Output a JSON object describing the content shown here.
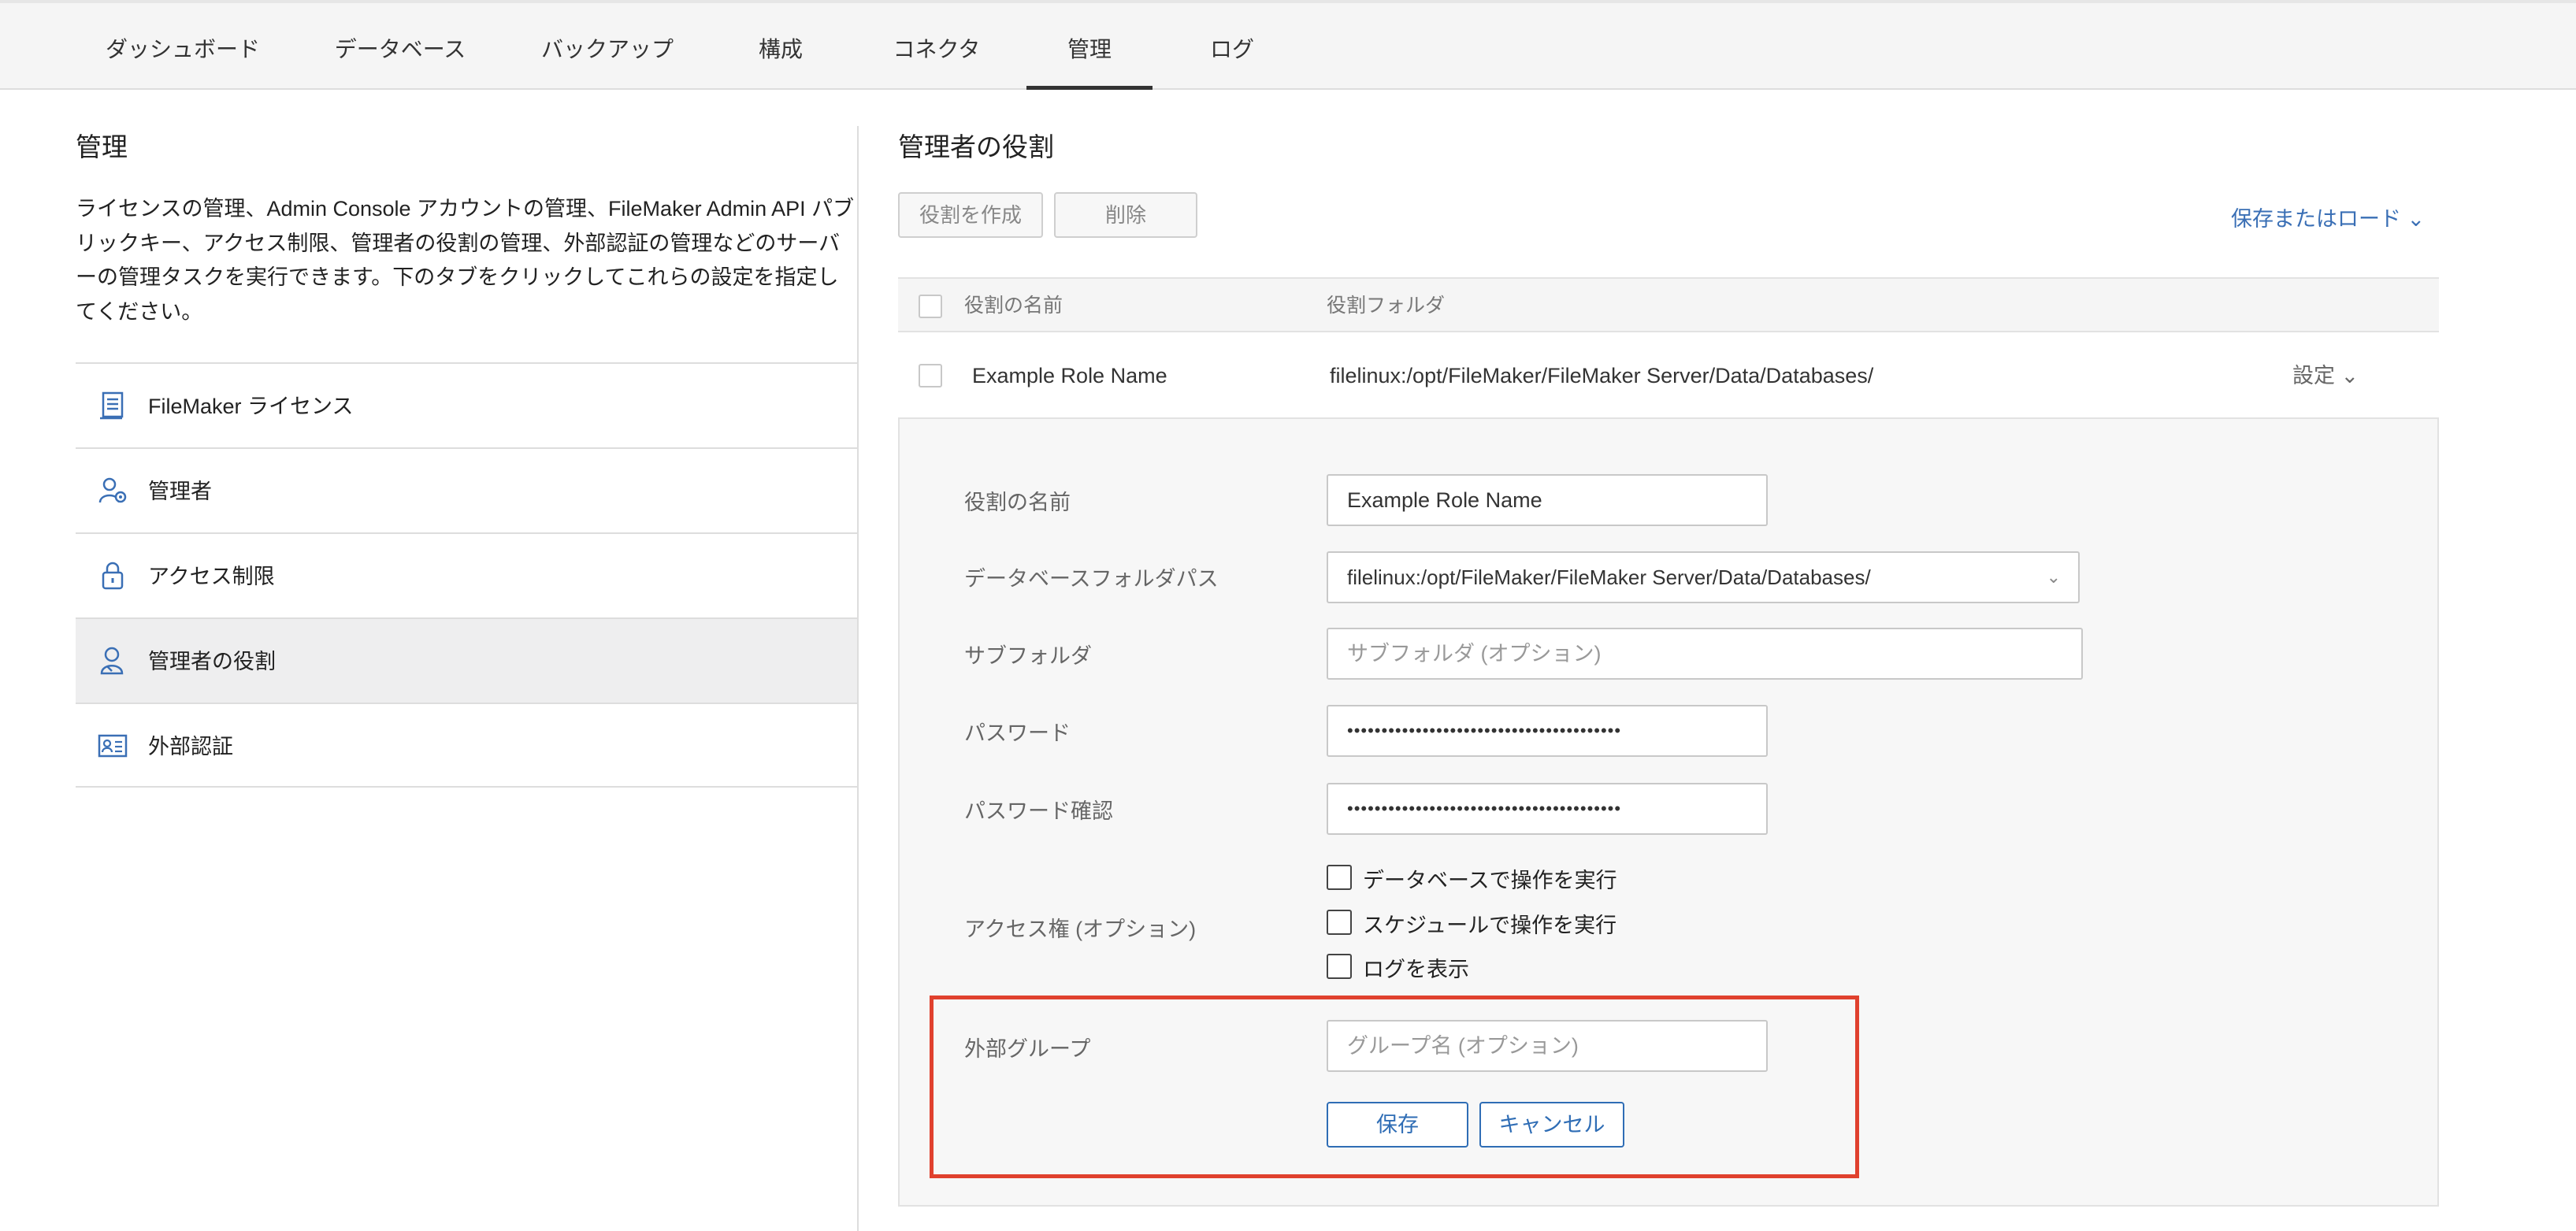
{
  "nav": {
    "tabs": [
      {
        "label": "ダッシュボード"
      },
      {
        "label": "データベース"
      },
      {
        "label": "バックアップ"
      },
      {
        "label": "構成"
      },
      {
        "label": "コネクタ"
      },
      {
        "label": "管理"
      },
      {
        "label": "ログ"
      }
    ],
    "active_tab": "管理"
  },
  "left": {
    "title": "管理",
    "description": "ライセンスの管理、Admin Console アカウントの管理、FileMaker Admin API パブリックキー、アクセス制限、管理者の役割の管理、外部認証の管理などのサーバーの管理タスクを実行できます。下のタブをクリックしてこれらの設定を指定してください。",
    "items": [
      {
        "label": "FileMaker ライセンス",
        "icon": "license-document-icon"
      },
      {
        "label": "管理者",
        "icon": "admin-user-gear-icon"
      },
      {
        "label": "アクセス制限",
        "icon": "lock-icon"
      },
      {
        "label": "管理者の役割",
        "icon": "admin-role-icon"
      },
      {
        "label": "外部認証",
        "icon": "id-card-icon"
      }
    ],
    "active_item": "管理者の役割"
  },
  "main": {
    "title": "管理者の役割",
    "create_label": "役割を作成",
    "delete_label": "削除",
    "save_load_label": "保存またはロード ⌄",
    "table": {
      "headers": [
        "役割の名前",
        "役割フォルダ"
      ],
      "row": {
        "name": "Example Role Name",
        "folder": "filelinux:/opt/FileMaker/FileMaker Server/Data/Databases/",
        "settings_label": "設定 ⌄"
      }
    },
    "form": {
      "role_name_label": "役割の名前",
      "role_name_value": "Example Role Name",
      "db_path_label": "データベースフォルダパス",
      "db_path_value": "filelinux:/opt/FileMaker/FileMaker Server/Data/Databases/",
      "subfolder_label": "サブフォルダ",
      "subfolder_placeholder": "サブフォルダ (オプション)",
      "password_label": "パスワード",
      "password_value": "••••••••••••••••••••••••••••••••••••••••",
      "password_confirm_label": "パスワード確認",
      "password_confirm_value": "••••••••••••••••••••••••••••••••••••••••",
      "access_label": "アクセス権 (オプション)",
      "access_options": [
        {
          "label": "データベースで操作を実行",
          "checked": false
        },
        {
          "label": "スケジュールで操作を実行",
          "checked": false
        },
        {
          "label": "ログを表示",
          "checked": false
        }
      ],
      "external_group_label": "外部グループ",
      "external_group_placeholder": "グループ名 (オプション)",
      "save_label": "保存",
      "cancel_label": "キャンセル"
    }
  },
  "colors": {
    "accent_blue": "#2f6db5",
    "highlight_red": "#e0412e"
  }
}
